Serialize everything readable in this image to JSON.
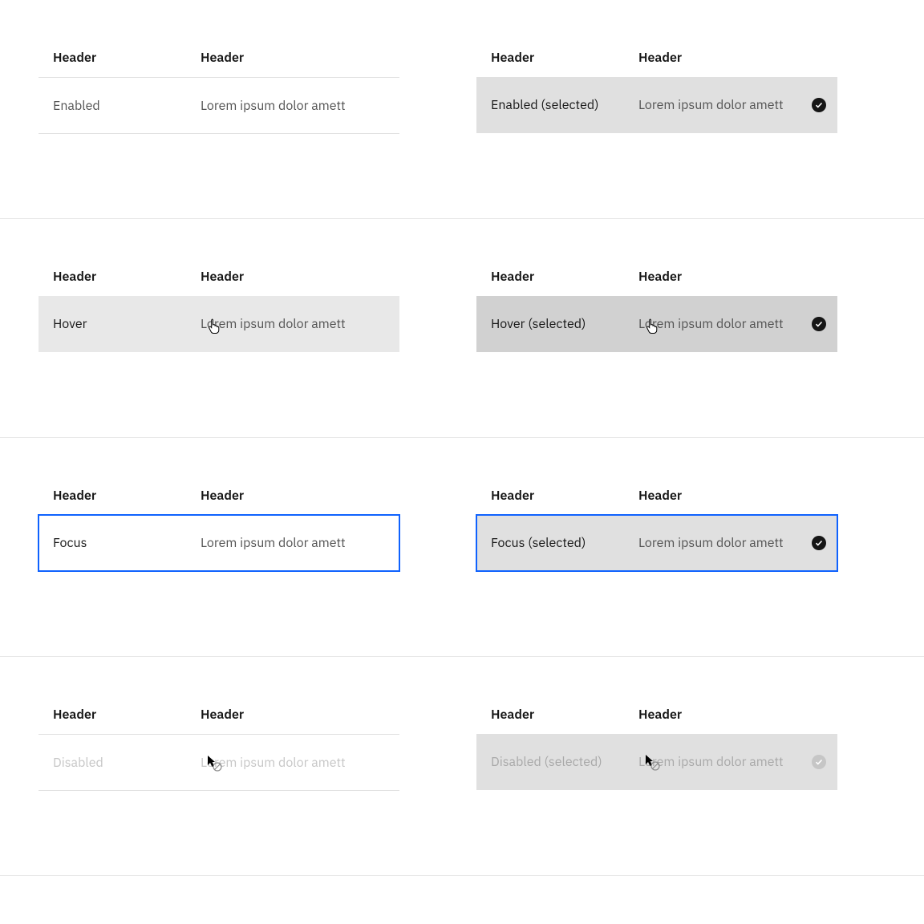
{
  "header_label": "Header",
  "lorem": "Lorem ipsum dolor amett",
  "states": {
    "enabled": "Enabled",
    "enabled_selected": "Enabled (selected)",
    "hover": "Hover",
    "hover_selected": "Hover (selected)",
    "focus": "Focus",
    "focus_selected": "Focus (selected)",
    "disabled": "Disabled",
    "disabled_selected": "Disabled (selected)"
  }
}
